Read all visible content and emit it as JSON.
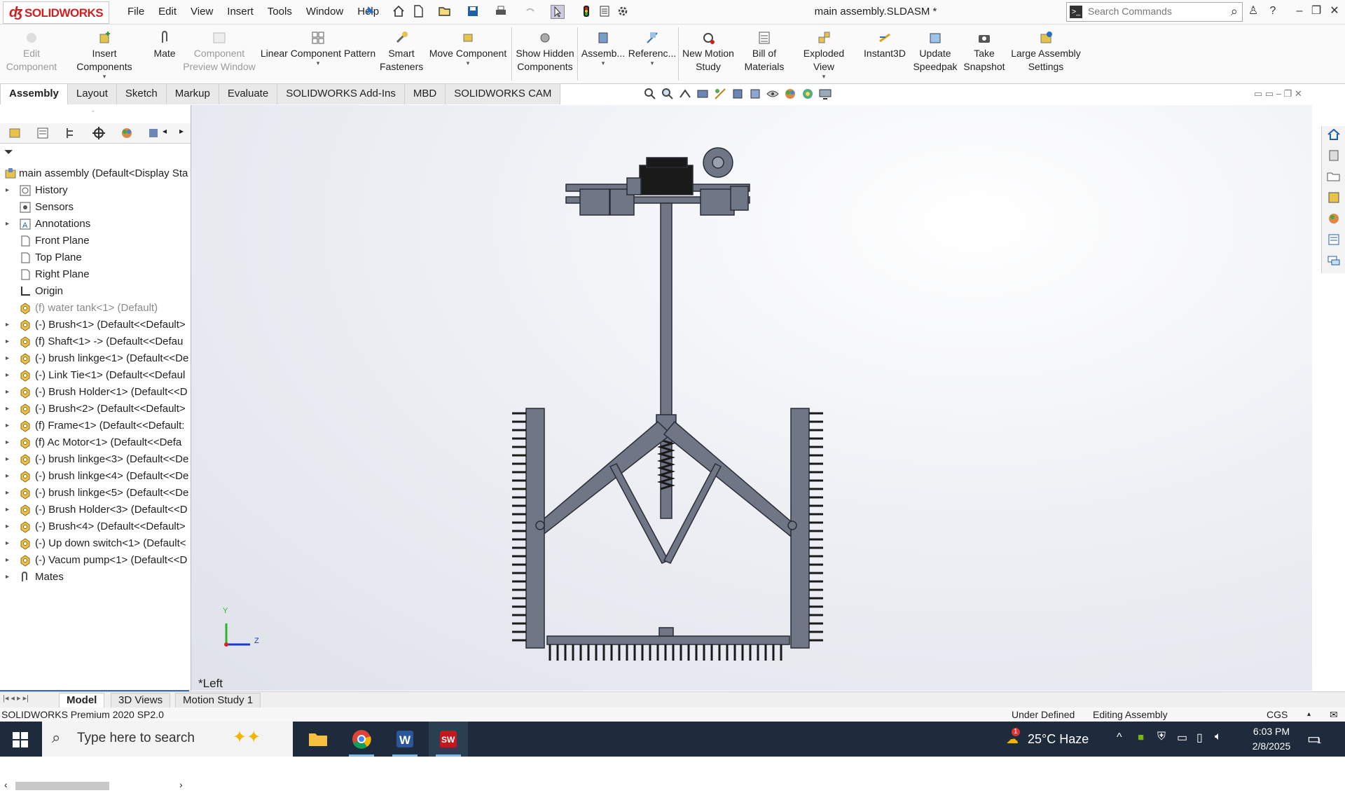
{
  "app": {
    "logo_text": "SOLIDWORKS",
    "menu": [
      "File",
      "Edit",
      "View",
      "Insert",
      "Tools",
      "Window",
      "Help"
    ],
    "document_title": "main assembly.SLDASM *",
    "search_placeholder": "Search Commands"
  },
  "commands": [
    {
      "id": "edit-component",
      "label": "Edit Component",
      "disabled": true
    },
    {
      "id": "insert-components",
      "label": "Insert Components",
      "disabled": false
    },
    {
      "id": "mate",
      "label": "Mate",
      "disabled": false
    },
    {
      "id": "component-preview-window",
      "label": "Component Preview Window",
      "disabled": true
    },
    {
      "id": "linear-component-pattern",
      "label": "Linear Component Pattern",
      "disabled": false
    },
    {
      "id": "smart-fasteners",
      "label": "Smart Fasteners",
      "disabled": false
    },
    {
      "id": "move-component",
      "label": "Move Component",
      "disabled": false
    },
    {
      "id": "show-hidden-components",
      "label": "Show Hidden Components",
      "disabled": false
    },
    {
      "id": "assembly-features",
      "label": "Assemb...",
      "disabled": false
    },
    {
      "id": "reference-geometry",
      "label": "Referenc...",
      "disabled": false
    },
    {
      "id": "new-motion-study",
      "label": "New Motion Study",
      "disabled": false
    },
    {
      "id": "bill-of-materials",
      "label": "Bill of Materials",
      "disabled": false
    },
    {
      "id": "exploded-view",
      "label": "Exploded View",
      "disabled": false
    },
    {
      "id": "instant3d",
      "label": "Instant3D",
      "disabled": false
    },
    {
      "id": "update-speedpak",
      "label": "Update Speedpak",
      "disabled": false
    },
    {
      "id": "take-snapshot",
      "label": "Take Snapshot",
      "disabled": false
    },
    {
      "id": "large-assembly-settings",
      "label": "Large Assembly Settings",
      "disabled": false
    }
  ],
  "tabs": [
    "Assembly",
    "Layout",
    "Sketch",
    "Markup",
    "Evaluate",
    "SOLIDWORKS Add-Ins",
    "MBD",
    "SOLIDWORKS CAM"
  ],
  "active_tab": "Assembly",
  "tree": {
    "root": "main assembly  (Default<Display Sta",
    "items": [
      {
        "label": "History",
        "icon": "history-icon",
        "expandable": true,
        "gray": false
      },
      {
        "label": "Sensors",
        "icon": "sensor-icon",
        "expandable": false,
        "gray": false
      },
      {
        "label": "Annotations",
        "icon": "annotation-icon",
        "expandable": true,
        "gray": false
      },
      {
        "label": "Front Plane",
        "icon": "plane-icon",
        "expandable": false,
        "gray": false
      },
      {
        "label": "Top Plane",
        "icon": "plane-icon",
        "expandable": false,
        "gray": false
      },
      {
        "label": "Right Plane",
        "icon": "plane-icon",
        "expandable": false,
        "gray": false
      },
      {
        "label": "Origin",
        "icon": "origin-icon",
        "expandable": false,
        "gray": false
      },
      {
        "label": "(f) water tank<1> (Default)",
        "icon": "part-icon",
        "expandable": false,
        "gray": true
      },
      {
        "label": "(-) Brush<1> (Default<<Default>",
        "icon": "part-icon",
        "expandable": true,
        "gray": false
      },
      {
        "label": "(f) Shaft<1> -> (Default<<Defau",
        "icon": "part-icon",
        "expandable": true,
        "gray": false
      },
      {
        "label": "(-) brush linkge<1> (Default<<De",
        "icon": "part-icon",
        "expandable": true,
        "gray": false
      },
      {
        "label": "(-) Link Tie<1> (Default<<Defaul",
        "icon": "part-icon",
        "expandable": true,
        "gray": false
      },
      {
        "label": "(-) Brush Holder<1> (Default<<D",
        "icon": "part-icon",
        "expandable": true,
        "gray": false
      },
      {
        "label": "(-) Brush<2> (Default<<Default>",
        "icon": "part-icon",
        "expandable": true,
        "gray": false
      },
      {
        "label": "(f) Frame<1> (Default<<Default:",
        "icon": "part-icon",
        "expandable": true,
        "gray": false
      },
      {
        "label": "(f) Ac Motor<1> (Default<<Defa",
        "icon": "part-icon",
        "expandable": true,
        "gray": false
      },
      {
        "label": "(-) brush linkge<3> (Default<<De",
        "icon": "part-icon",
        "expandable": true,
        "gray": false
      },
      {
        "label": "(-) brush linkge<4> (Default<<De",
        "icon": "part-icon",
        "expandable": true,
        "gray": false
      },
      {
        "label": "(-) brush linkge<5> (Default<<De",
        "icon": "part-icon",
        "expandable": true,
        "gray": false
      },
      {
        "label": "(-) Brush Holder<3> (Default<<D",
        "icon": "part-icon",
        "expandable": true,
        "gray": false
      },
      {
        "label": "(-) Brush<4> (Default<<Default>",
        "icon": "part-icon",
        "expandable": true,
        "gray": false
      },
      {
        "label": "(-) Up down switch<1> (Default<",
        "icon": "part-icon",
        "expandable": true,
        "gray": false
      },
      {
        "label": "(-) Vacum pump<1> (Default<<D",
        "icon": "part-icon",
        "expandable": true,
        "gray": false
      },
      {
        "label": "Mates",
        "icon": "mates-icon",
        "expandable": true,
        "gray": false
      }
    ]
  },
  "graphics": {
    "view_name": "*Left",
    "triad_y": "Y",
    "triad_z": "Z"
  },
  "bottom_tabs": [
    "Model",
    "3D Views",
    "Motion Study 1"
  ],
  "active_bottom_tab": "Model",
  "status": {
    "product": "SOLIDWORKS Premium 2020 SP2.0",
    "definition": "Under Defined",
    "mode": "Editing Assembly",
    "units": "CGS"
  },
  "taskbar": {
    "search_placeholder": "Type here to search",
    "weather": "25°C  Haze",
    "weather_badge": "1",
    "time": "6:03 PM",
    "date": "2/8/2025",
    "notification_count": "1"
  },
  "colors": {
    "accent": "#d21f1f",
    "model_metal": "#6f7686",
    "taskbar": "#1d2b3c"
  }
}
